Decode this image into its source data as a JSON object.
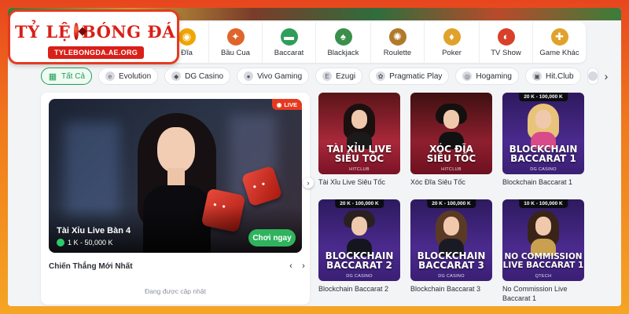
{
  "logo": {
    "title_left": "TỶ LỆ",
    "title_right": "BÓNG ĐÁ",
    "url": "TYLEBONGDA.AE.ORG"
  },
  "categories": [
    {
      "label": "Đĩa",
      "icon": "disc-icon",
      "color": "#f0a500"
    },
    {
      "label": "Bầu Cua",
      "icon": "crab-icon",
      "color": "#e0652b"
    },
    {
      "label": "Baccarat",
      "icon": "baccarat-table-icon",
      "color": "#2f9e5a"
    },
    {
      "label": "Blackjack",
      "icon": "cards-icon",
      "color": "#3a8f4b"
    },
    {
      "label": "Roulette",
      "icon": "roulette-wheel-icon",
      "color": "#b07a2a"
    },
    {
      "label": "Poker",
      "icon": "poker-chip-icon",
      "color": "#e0a22b"
    },
    {
      "label": "TV Show",
      "icon": "tv-show-icon",
      "color": "#d9402b"
    },
    {
      "label": "Game Khác",
      "icon": "more-games-icon",
      "color": "#e0a22b"
    }
  ],
  "filters": [
    {
      "label": "Tất Cả",
      "active": true
    },
    {
      "label": "Evolution",
      "active": false
    },
    {
      "label": "DG Casino",
      "active": false
    },
    {
      "label": "Vivo Gaming",
      "active": false
    },
    {
      "label": "Ezugi",
      "active": false
    },
    {
      "label": "Pragmatic Play",
      "active": false
    },
    {
      "label": "Hogaming",
      "active": false
    },
    {
      "label": "Hit.Club",
      "active": false
    }
  ],
  "featured": {
    "live_badge": "LIVE",
    "title": "Tài Xỉu Live Bàn 4",
    "limit": "1 K - 50,000 K",
    "play_label": "Chơi ngay",
    "winners_title": "Chiến Thắng Mới Nhất",
    "updating_text": "Đang được cập nhật"
  },
  "games": [
    {
      "name": "Tài Xỉu Live Siêu Tốc",
      "caption_1": "TÀI XỈU LIVE",
      "caption_2": "SIÊU TỐC",
      "provider": "HITCLUB",
      "limit": "",
      "bg": "bg-red"
    },
    {
      "name": "Xóc Đĩa Siêu Tốc",
      "caption_1": "XÓC ĐĨA",
      "caption_2": "SIÊU TỐC",
      "provider": "HITCLUB",
      "limit": "",
      "bg": "bg-red2"
    },
    {
      "name": "Blockchain Baccarat 1",
      "caption_1": "BLOCKCHAIN",
      "caption_2": "BACCARAT 1",
      "provider": "DG CASINO",
      "limit": "20 K - 100,000 K",
      "bg": "bg-purple"
    },
    {
      "name": "Blockchain Baccarat 2",
      "caption_1": "BLOCKCHAIN",
      "caption_2": "BACCARAT 2",
      "provider": "DG CASINO",
      "limit": "20 K - 100,000 K",
      "bg": "bg-purple"
    },
    {
      "name": "Blockchain Baccarat 3",
      "caption_1": "BLOCKCHAIN",
      "caption_2": "BACCARAT 3",
      "provider": "DG CASINO",
      "limit": "20 K - 100,000 K",
      "bg": "bg-purple"
    },
    {
      "name": "No Commission Live Baccarat 1",
      "caption_1": "NO COMMISSION",
      "caption_2": "LIVE BACCARAT 1",
      "provider": "QTECH",
      "limit": "10 K - 100,000 K",
      "bg": "bg-purple"
    }
  ]
}
